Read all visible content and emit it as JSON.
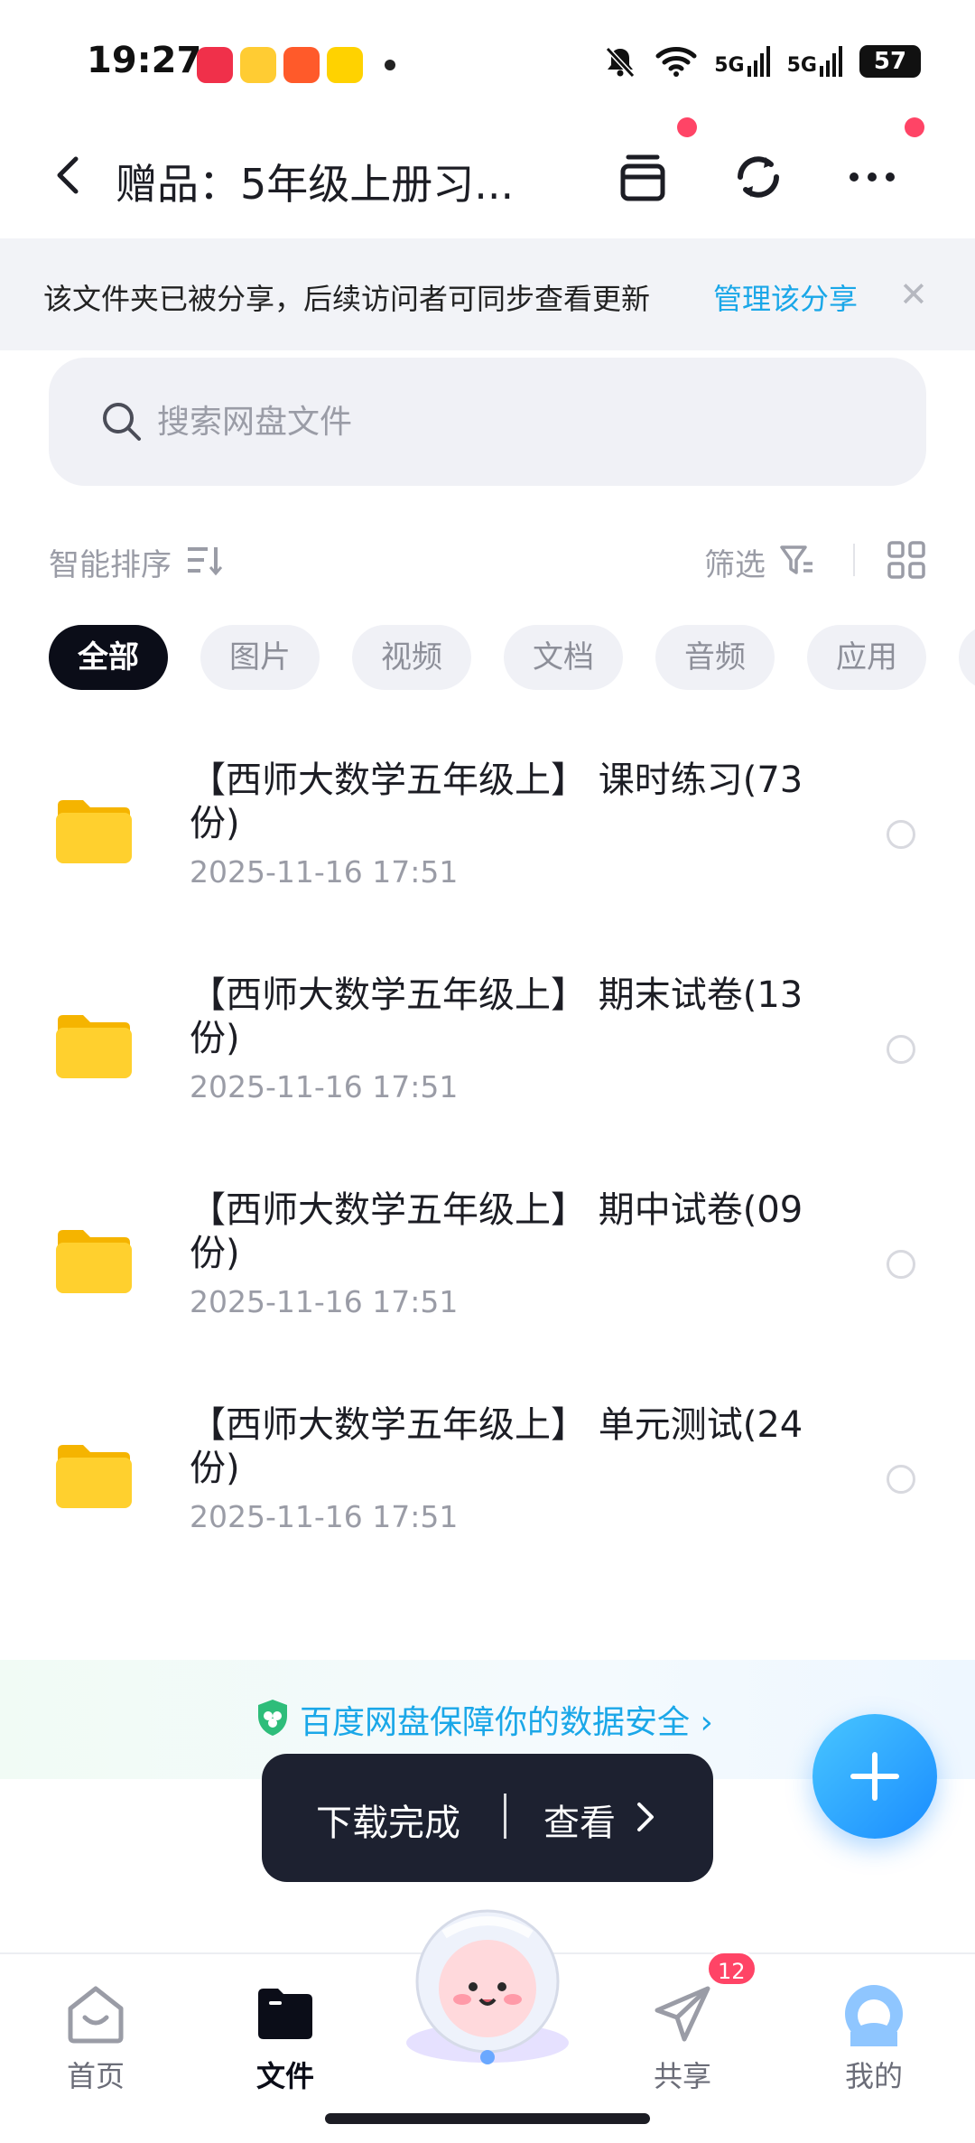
{
  "status_bar": {
    "time": "19:27",
    "signal_1": "5G",
    "signal_2": "5G",
    "battery": "57",
    "apps": [
      "xiaohongshu-icon",
      "weibo-icon",
      "video-app-icon",
      "meituan-icon"
    ]
  },
  "header": {
    "title": "赠品：5年级上册习...",
    "icons": [
      "back-icon",
      "inbox-icon",
      "sync-icon",
      "more-icon"
    ]
  },
  "share_banner": {
    "text": "该文件夹已被分享，后续访问者可同步查看更新",
    "link": "管理该分享"
  },
  "search": {
    "placeholder": "搜索网盘文件"
  },
  "sort_bar": {
    "sort_label": "智能排序",
    "filter_label": "筛选"
  },
  "filters": {
    "chips": [
      "全部",
      "图片",
      "视频",
      "文档",
      "音频",
      "应用"
    ],
    "active_index": 0
  },
  "files": [
    {
      "name": "【西师大数学五年级上】 课时练习(73份)",
      "date": "2025-11-16  17:51"
    },
    {
      "name": "【西师大数学五年级上】 期末试卷(13份)",
      "date": "2025-11-16  17:51"
    },
    {
      "name": "【西师大数学五年级上】 期中试卷(09份)",
      "date": "2025-11-16  17:51"
    },
    {
      "name": "【西师大数学五年级上】 单元测试(24份)",
      "date": "2025-11-16  17:51"
    }
  ],
  "security_banner": {
    "text": "百度网盘保障你的数据安全"
  },
  "toast": {
    "message": "下载完成",
    "action": "查看"
  },
  "tabbar": {
    "tabs": [
      "首页",
      "文件",
      "共享",
      "我的"
    ],
    "active_index": 1,
    "share_badge": "12"
  },
  "colors": {
    "accent": "#1aa7e8",
    "notification": "#ff4466",
    "chip_active_bg": "#0b0d18",
    "folder": "#ffc928"
  }
}
